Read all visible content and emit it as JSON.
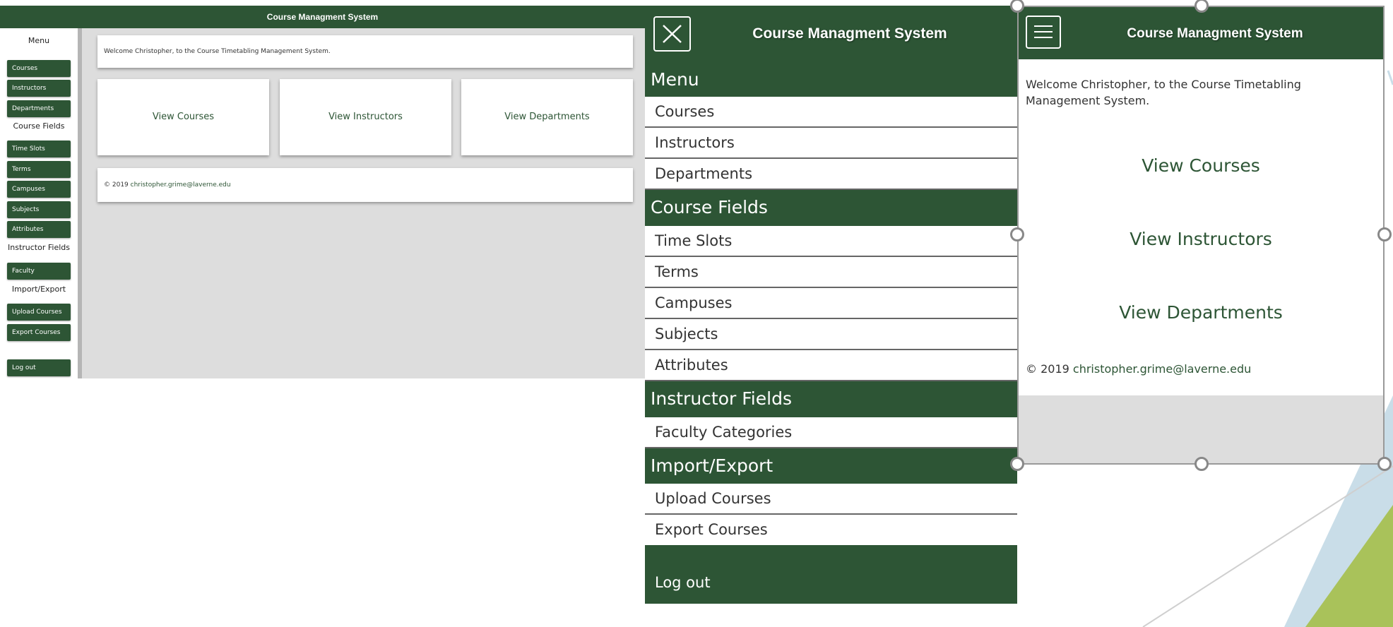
{
  "app_title": "Course Managment System",
  "welcome_text": "Welcome Christopher, to the Course Timetabling Management System.",
  "sidebar": {
    "menu_heading": "Menu",
    "menu_items": [
      "Courses",
      "Instructors",
      "Departments"
    ],
    "course_fields_heading": "Course Fields",
    "course_field_items": [
      "Time Slots",
      "Terms",
      "Campuses",
      "Subjects",
      "Attributes"
    ],
    "instructor_fields_heading": "Instructor Fields",
    "instructor_field_items": [
      "Faculty Categories"
    ],
    "import_export_heading": "Import/Export",
    "import_export_items": [
      "Upload Courses",
      "Export Courses"
    ],
    "logout_label": "Log out"
  },
  "cards": [
    "View Courses",
    "View Instructors",
    "View Departments"
  ],
  "footer": {
    "copyright": "© 2019",
    "email": "christopher.grime@laverne.edu"
  },
  "icons": {
    "close": "close-icon",
    "menu": "hamburger-menu-icon"
  },
  "colors": {
    "brand_green": "#2d5535",
    "background_gray": "#dddddd",
    "deco_blue": "#c9dde8",
    "deco_olive": "#a9c25a"
  }
}
